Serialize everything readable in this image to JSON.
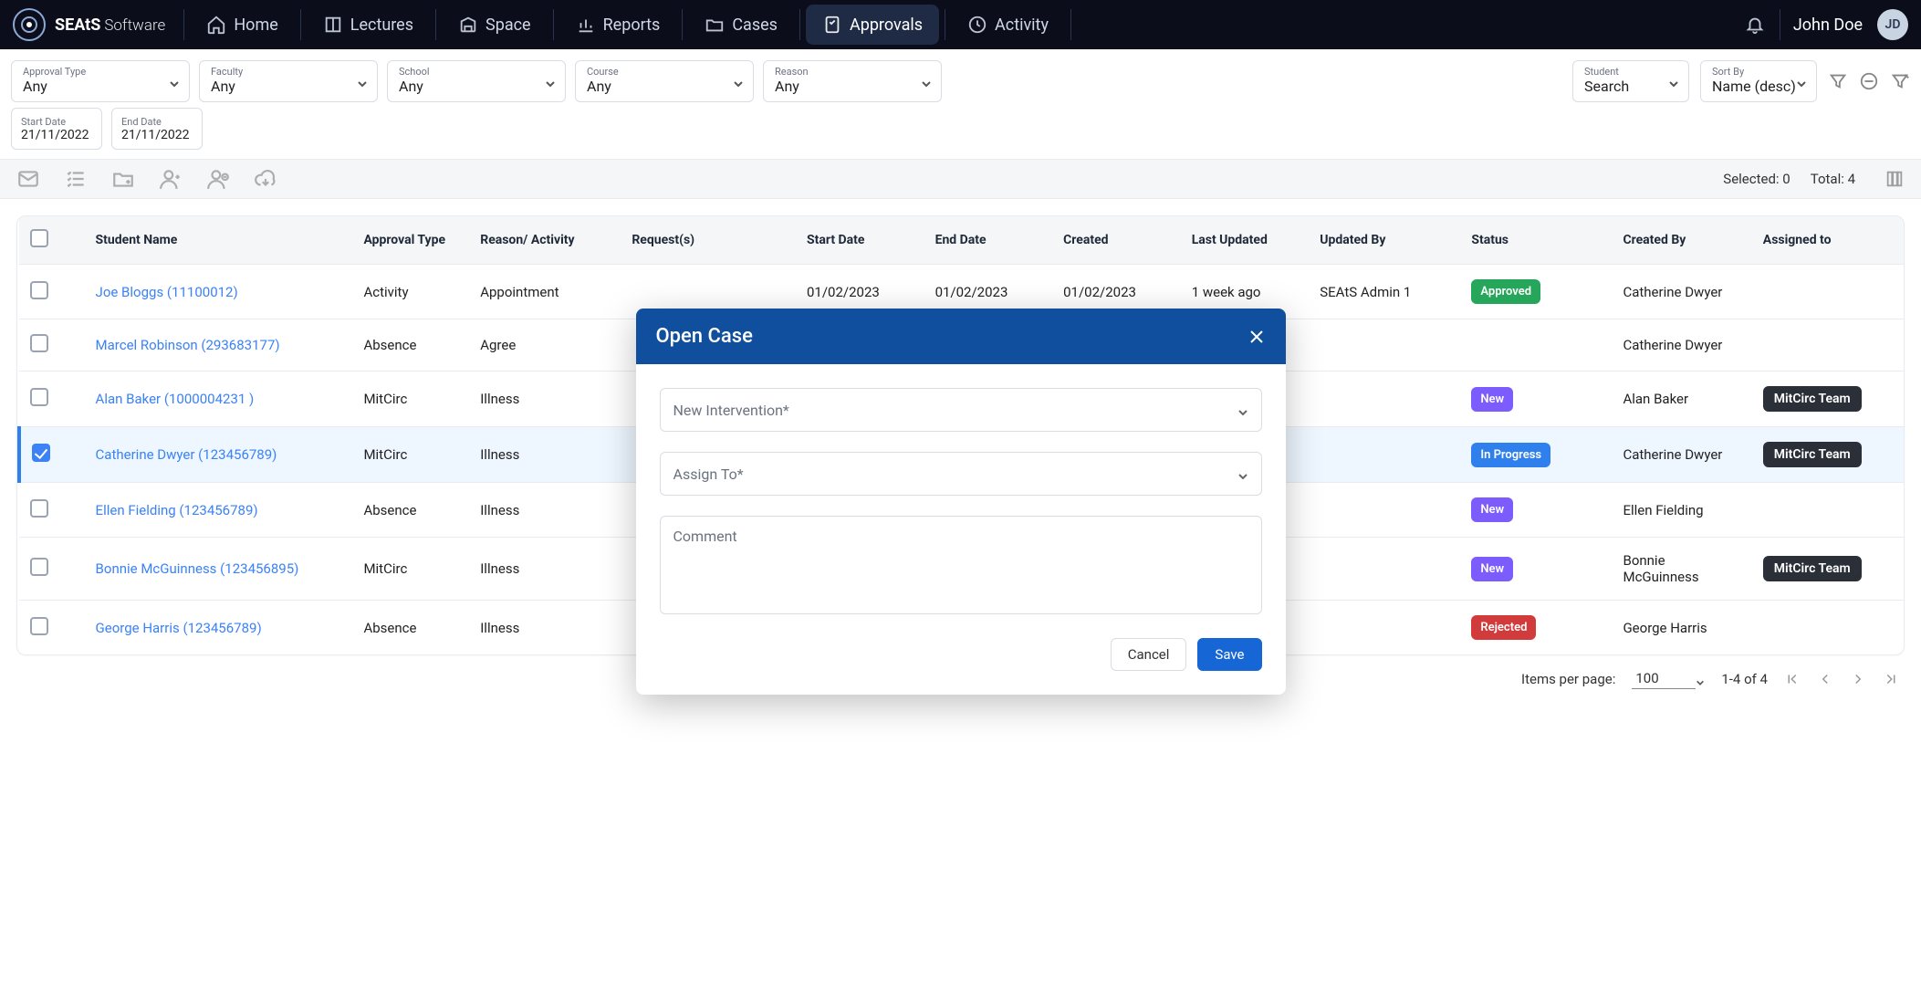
{
  "brand": {
    "name_strong": "SEAtS",
    "name_soft": "Software"
  },
  "nav": {
    "items": [
      {
        "label": "Home",
        "icon": "home"
      },
      {
        "label": "Lectures",
        "icon": "lectern"
      },
      {
        "label": "Space",
        "icon": "building"
      },
      {
        "label": "Reports",
        "icon": "chart"
      },
      {
        "label": "Cases",
        "icon": "folder"
      },
      {
        "label": "Approvals",
        "icon": "checklist",
        "active": true
      },
      {
        "label": "Activity",
        "icon": "history"
      }
    ],
    "user_name": "John Doe",
    "user_initials": "JD"
  },
  "filters": {
    "approval_type": {
      "label": "Approval Type",
      "value": "Any"
    },
    "faculty": {
      "label": "Faculty",
      "value": "Any"
    },
    "school": {
      "label": "School",
      "value": "Any"
    },
    "course": {
      "label": "Course",
      "value": "Any"
    },
    "reason": {
      "label": "Reason",
      "value": "Any"
    },
    "search": {
      "label": "Student",
      "value": "Search"
    },
    "sort": {
      "label": "Sort By",
      "value": "Name (desc)"
    },
    "start_date": {
      "label": "Start Date",
      "value": "21/11/2022"
    },
    "end_date": {
      "label": "End Date",
      "value": "21/11/2022"
    }
  },
  "action_strip": {
    "selected_label": "Selected: 0",
    "total_label": "Total: 4"
  },
  "table": {
    "headers": {
      "student": "Student Name",
      "approval_type": "Approval Type",
      "reason": "Reason/ Activity",
      "requests": "Request(s)",
      "start": "Start Date",
      "end": "End Date",
      "created": "Created",
      "last_updated": "Last Updated",
      "updated_by": "Updated By",
      "status": "Status",
      "created_by": "Created By",
      "assigned_to": "Assigned to"
    },
    "rows": [
      {
        "checked": false,
        "student": "Joe Bloggs (11100012)",
        "type": "Activity",
        "reason": "Appointment",
        "requests": "",
        "start": "01/02/2023",
        "end": "01/02/2023",
        "created": "01/02/2023",
        "last_updated": "1 week ago",
        "updated_by": "SEAtS Admin 1",
        "status": "Approved",
        "status_class": "approved",
        "created_by": "Catherine Dwyer",
        "assigned_to": ""
      },
      {
        "checked": false,
        "student": "Marcel Robinson (293683177)",
        "type": "Absence",
        "reason": "Agree",
        "requests": "",
        "start": "",
        "end": "",
        "created": "",
        "last_updated": "",
        "updated_by": "",
        "status": "",
        "status_class": "",
        "created_by": "Catherine Dwyer",
        "assigned_to": ""
      },
      {
        "checked": false,
        "student": "Alan Baker (1000004231 )",
        "type": "MitCirc",
        "reason": "Illness",
        "requests": "",
        "start": "",
        "end": "",
        "created": "",
        "last_updated": "",
        "updated_by": "",
        "status": "New",
        "status_class": "new",
        "created_by": "Alan Baker",
        "assigned_to": "MitCirc Team"
      },
      {
        "checked": true,
        "student": "Catherine Dwyer  (123456789)",
        "type": "MitCirc",
        "reason": "Illness",
        "requests": "",
        "start": "",
        "end": "",
        "created": "",
        "last_updated": "",
        "updated_by": "",
        "status": "In Progress",
        "status_class": "progress",
        "created_by": "Catherine Dwyer",
        "assigned_to": "MitCirc Team"
      },
      {
        "checked": false,
        "student": "Ellen Fielding (123456789)",
        "type": "Absence",
        "reason": "Illness",
        "requests": "",
        "start": "",
        "end": "",
        "created": "",
        "last_updated": "",
        "updated_by": "",
        "status": "New",
        "status_class": "new",
        "created_by": "Ellen Fielding",
        "assigned_to": ""
      },
      {
        "checked": false,
        "student": "Bonnie McGuinness (123456895)",
        "type": "MitCirc",
        "reason": "Illness",
        "requests": "",
        "start": "",
        "end": "",
        "created": "",
        "last_updated": "",
        "updated_by": "",
        "status": "New",
        "status_class": "new",
        "created_by": "Bonnie McGuinness",
        "assigned_to": "MitCirc Team"
      },
      {
        "checked": false,
        "student": "George Harris (123456789)",
        "type": "Absence",
        "reason": "Illness",
        "requests": "",
        "start": "",
        "end": "",
        "created": "",
        "last_updated": "",
        "updated_by": "",
        "status": "Rejected",
        "status_class": "rejected",
        "created_by": "George Harris",
        "assigned_to": ""
      }
    ]
  },
  "pagination": {
    "items_per_page_label": "Items per page:",
    "items_per_page_value": "100",
    "range": "1-4 of 4"
  },
  "modal": {
    "title": "Open Case",
    "field_intervention": "New Intervention*",
    "field_assign": "Assign To*",
    "field_comment": "Comment",
    "cancel": "Cancel",
    "save": "Save"
  }
}
